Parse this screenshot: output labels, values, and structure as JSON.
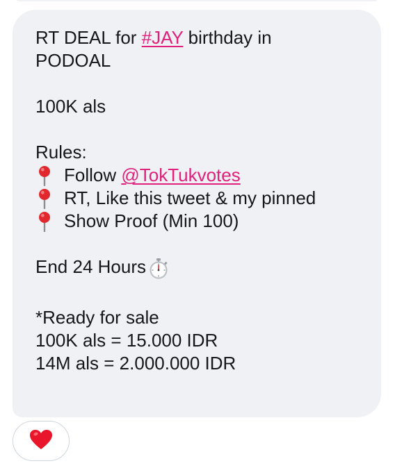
{
  "message": {
    "line1_prefix": "RT DEAL for ",
    "line1_hashtag": "#JAY",
    "line1_suffix": " birthday in",
    "line2": "PODOAL",
    "line3": "100K als",
    "rules_heading": "Rules:",
    "rule1_prefix": "Follow ",
    "rule1_mention": "@TokTukvotes",
    "rule2": "RT, Like this tweet & my pinned",
    "rule3": "Show Proof (Min 100)",
    "end_text": "End 24 Hours",
    "sale_heading": "*Ready for sale",
    "sale_line1": "100K als = 15.000 IDR",
    "sale_line2": "14M als = 2.000.000 IDR"
  },
  "icons": {
    "rule_bullet": "round-pushpin-icon",
    "timer": "stopwatch-icon",
    "reaction": "red-heart-icon"
  },
  "colors": {
    "bubble_bg": "#eff1f4",
    "link": "#e0217b",
    "text": "#14171a",
    "pin_head": "#e0282e",
    "heart": "#e8152b"
  }
}
